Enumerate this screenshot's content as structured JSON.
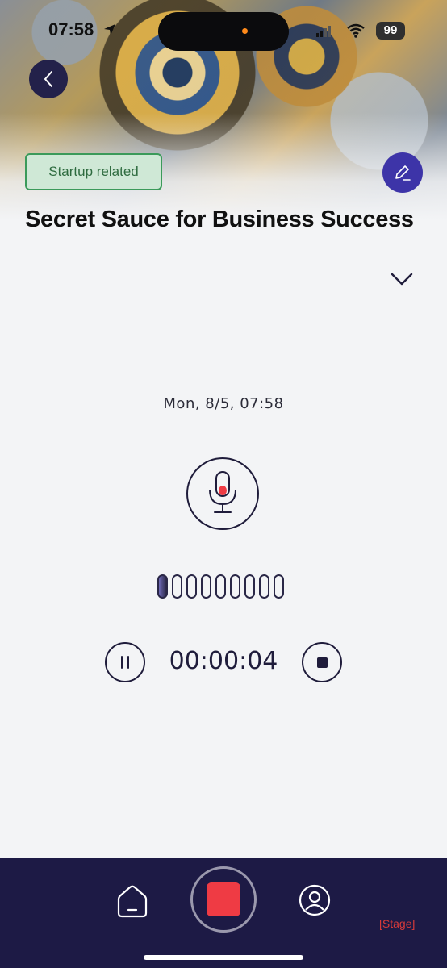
{
  "status_bar": {
    "time": "07:58",
    "battery": "99"
  },
  "header": {
    "tag": "Startup related",
    "title": "Secret Sauce for Business Success"
  },
  "recorder": {
    "date": "Mon, 8/5, 07:58",
    "elapsed": "00:00:04",
    "level_bars_total": 9,
    "level_bars_active": 1,
    "colors": {
      "accent": "#1f1c3b",
      "mic_dot": "#ef3b44",
      "record": "#ef3b44",
      "nav_bg": "#1d1a45",
      "tag_bg": "#cfe8d6",
      "tag_border": "#3b9a5a",
      "edit_bg": "#3d34a8"
    }
  },
  "nav": {
    "stage_label": "[Stage]"
  }
}
